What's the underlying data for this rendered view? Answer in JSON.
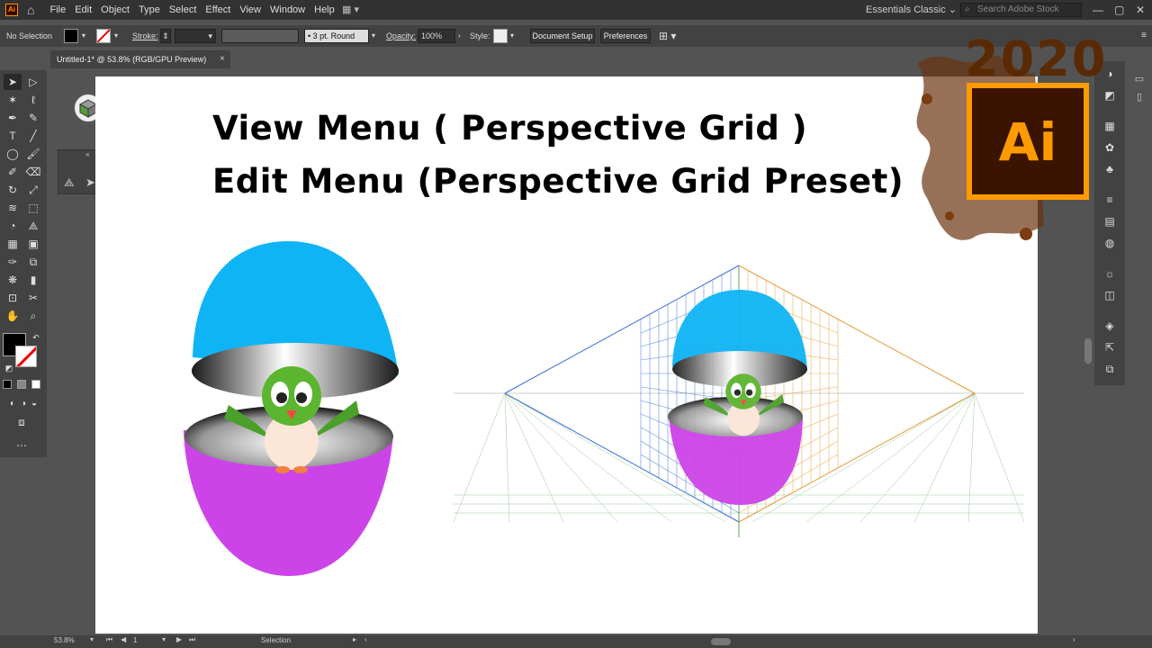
{
  "app": {
    "logo": "Ai"
  },
  "menu": [
    "File",
    "Edit",
    "Object",
    "Type",
    "Select",
    "Effect",
    "View",
    "Window",
    "Help"
  ],
  "workspace": "Essentials Classic",
  "search": {
    "placeholder": "Search Adobe Stock"
  },
  "control": {
    "selection": "No Selection",
    "stroke_label": "Stroke:",
    "brush": "3 pt. Round",
    "opacity_label": "Opacity:",
    "opacity_value": "100%",
    "style_label": "Style:",
    "doc_setup": "Document Setup",
    "preferences": "Preferences"
  },
  "tab": {
    "title": "Untitled-1* @ 53.8% (RGB/GPU Preview)",
    "close": "×"
  },
  "canvas": {
    "line1": "View Menu ( Perspective Grid )",
    "line2": "Edit Menu (Perspective Grid Preset)"
  },
  "brand": {
    "year": "2020",
    "logo": "Ai"
  },
  "status": {
    "zoom": "53.8%",
    "page": "1",
    "tool": "Selection"
  },
  "colors": {
    "egg_top": "#0fb4f5",
    "egg_bottom": "#cc44e8",
    "grid_left": "#3a6fd6",
    "grid_right": "#e89a3a",
    "grid_floor": "#5aa35a"
  }
}
